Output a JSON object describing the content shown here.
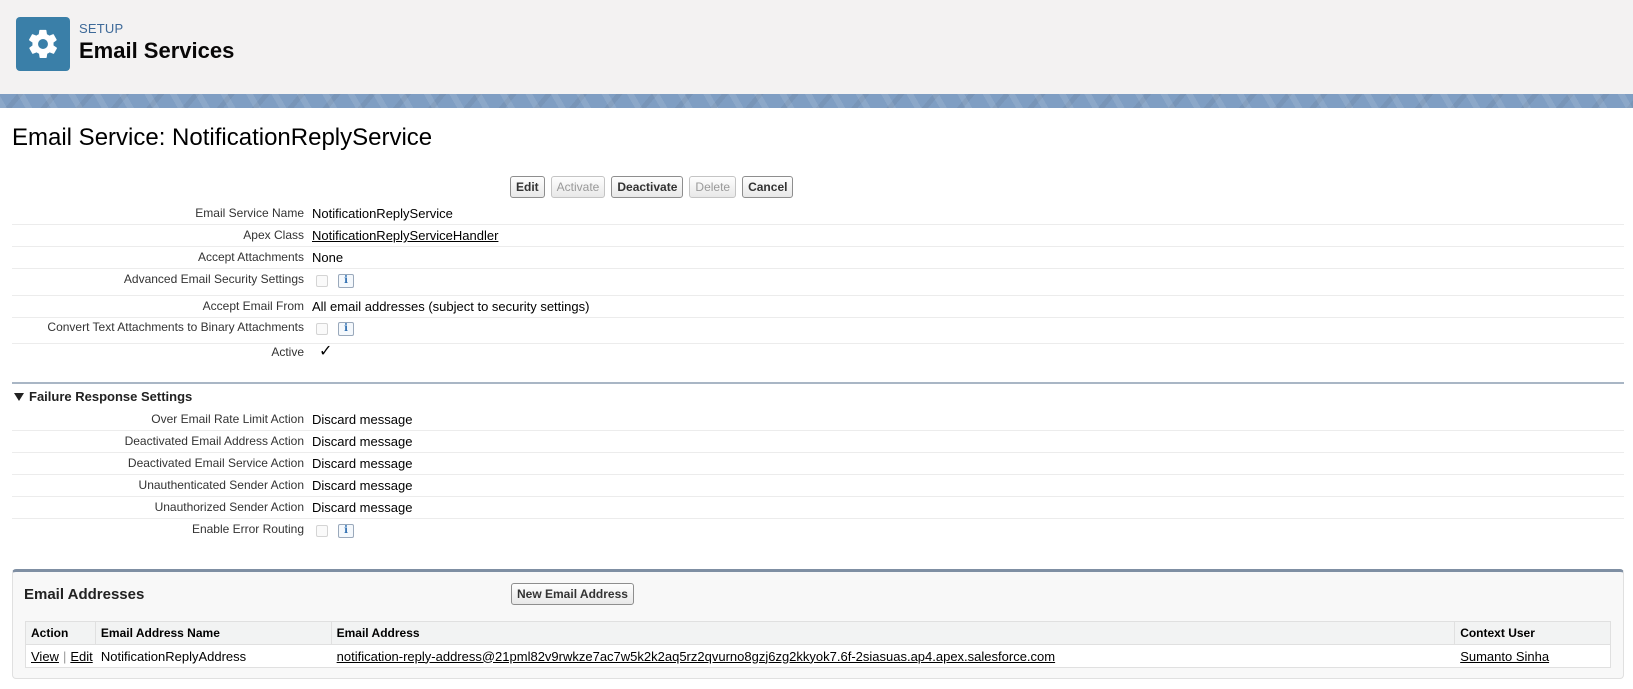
{
  "header": {
    "eyebrow": "SETUP",
    "title": "Email Services",
    "icon": "gear-icon",
    "icon_color": "#3a7fa8"
  },
  "page": {
    "title": "Email Service: NotificationReplyService"
  },
  "buttons": {
    "edit": "Edit",
    "activate": "Activate",
    "deactivate": "Deactivate",
    "delete": "Delete",
    "cancel": "Cancel"
  },
  "details": {
    "service_name_label": "Email Service Name",
    "service_name_value": "NotificationReplyService",
    "apex_class_label": "Apex Class",
    "apex_class_value": "NotificationReplyServiceHandler",
    "accept_attachments_label": "Accept Attachments",
    "accept_attachments_value": "None",
    "advanced_security_label": "Advanced Email Security Settings",
    "accept_from_label": "Accept Email From",
    "accept_from_value": "All email addresses (subject to security settings)",
    "convert_text_label": "Convert Text Attachments to Binary Attachments",
    "active_label": "Active",
    "active_mark": "✓",
    "info_glyph": "i"
  },
  "failure": {
    "section_title": "Failure Response Settings",
    "over_rate_label": "Over Email Rate Limit Action",
    "over_rate_value": "Discard message",
    "deactivated_address_label": "Deactivated Email Address Action",
    "deactivated_address_value": "Discard message",
    "deactivated_service_label": "Deactivated Email Service Action",
    "deactivated_service_value": "Discard message",
    "unauthenticated_label": "Unauthenticated Sender Action",
    "unauthenticated_value": "Discard message",
    "unauthorized_label": "Unauthorized Sender Action",
    "unauthorized_value": "Discard message",
    "error_routing_label": "Enable Error Routing"
  },
  "addresses": {
    "title": "Email Addresses",
    "new_button": "New Email Address",
    "columns": [
      "Action",
      "Email Address Name",
      "Email Address",
      "Context User"
    ],
    "rows": [
      {
        "view": "View",
        "separator": "|",
        "edit": "Edit",
        "name": "NotificationReplyAddress",
        "address": "notification-reply-address@21pml82v9rwkze7ac7w5k2k2aq5rz2qvurno8gzj6zg2kkyok7.6f-2siasuas.ap4.apex.salesforce.com",
        "user": "Sumanto Sinha"
      }
    ]
  }
}
